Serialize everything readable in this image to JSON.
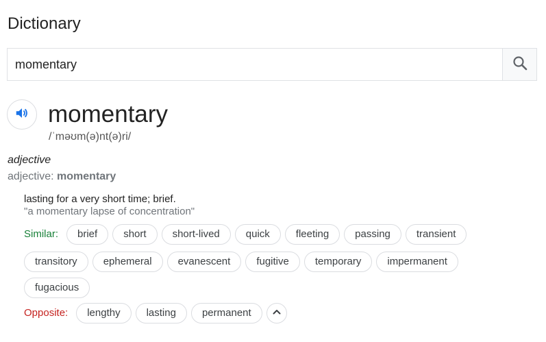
{
  "header": {
    "title": "Dictionary"
  },
  "search": {
    "value": "momentary"
  },
  "entry": {
    "word": "momentary",
    "pronunciation": "/ˈməʊm(ə)nt(ə)ri/",
    "part_of_speech": "adjective",
    "pos_prefix": "adjective: ",
    "pos_word": "momentary",
    "definition": "lasting for a very short time; brief.",
    "example": "\"a momentary lapse of concentration\""
  },
  "similar": {
    "label": "Similar:",
    "row1": [
      "brief",
      "short",
      "short-lived",
      "quick",
      "fleeting",
      "passing",
      "transient"
    ],
    "row2": [
      "transitory",
      "ephemeral",
      "evanescent",
      "fugitive",
      "temporary",
      "impermanent"
    ],
    "row3": [
      "fugacious"
    ]
  },
  "opposite": {
    "label": "Opposite:",
    "items": [
      "lengthy",
      "lasting",
      "permanent"
    ]
  },
  "icons": {
    "search": "search-icon",
    "speaker": "speaker-icon",
    "collapse": "chevron-up-icon"
  },
  "colors": {
    "similar_label": "#188038",
    "opposite_label": "#c5221f",
    "speaker_blue": "#1a73e8"
  }
}
